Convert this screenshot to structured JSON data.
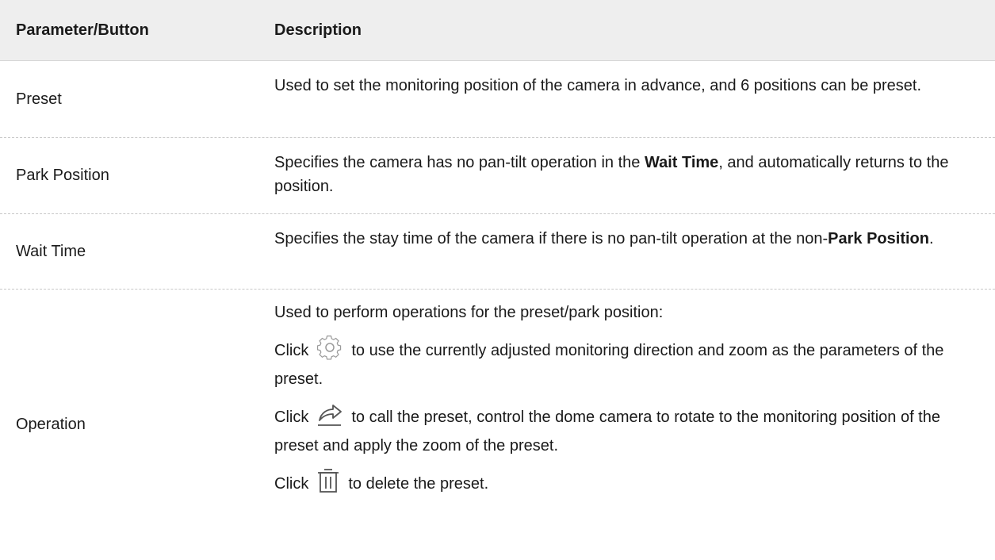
{
  "header": {
    "param": "Parameter/Button",
    "desc": "Description"
  },
  "rows": [
    {
      "param": "Preset",
      "desc": "Used to set the monitoring position of the camera in advance, and 6 positions can be preset."
    },
    {
      "param": "Park Position",
      "desc_a": "Specifies the camera has no pan-tilt operation in the ",
      "desc_bold": "Wait Time",
      "desc_b": ", and automatically returns to the position."
    },
    {
      "param": "Wait Time",
      "desc_a": "Specifies the stay time of the camera if there is no pan-tilt operation at the non-",
      "desc_bold": "Park Position",
      "desc_b": "."
    },
    {
      "param": "Operation",
      "intro": "Used to perform operations for the preset/park position:",
      "click_label": "Click",
      "settings_text": "to use the currently adjusted monitoring direction and zoom as the parameters of the preset.",
      "call_text": "to call the preset, control the dome camera to rotate to the monitoring position of the preset and apply the zoom of the preset.",
      "delete_text": "to delete the preset.",
      "icons": [
        "gear-icon",
        "share-arrow-icon",
        "trash-icon"
      ]
    }
  ]
}
